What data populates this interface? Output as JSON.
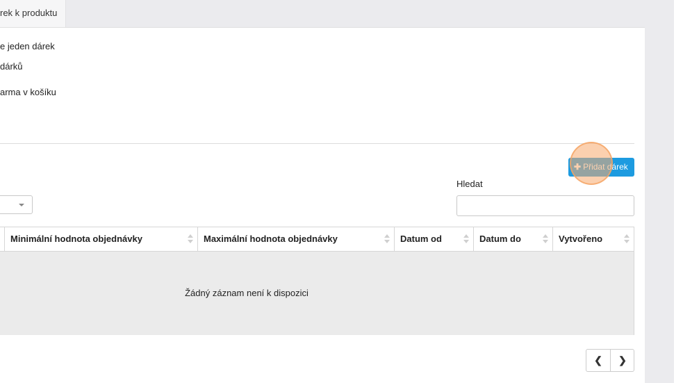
{
  "tab": {
    "label": "rek k produktu"
  },
  "options": [
    {
      "label": "e jeden dárek"
    },
    {
      "label": "dárků"
    },
    {
      "label": "arma v košíku"
    }
  ],
  "toolbar": {
    "add_button_label": "Přidat dárek",
    "add_icon": "plus-icon"
  },
  "search": {
    "label": "Hledat",
    "value": "",
    "placeholder": ""
  },
  "table": {
    "columns": [
      {
        "label": "Minimální hodnota objednávky"
      },
      {
        "label": "Maximální hodnota objednávky"
      },
      {
        "label": "Datum od"
      },
      {
        "label": "Datum do"
      },
      {
        "label": "Vytvořeno"
      }
    ],
    "empty_message": "Žádný záznam není k dispozici"
  },
  "pagination": {
    "prev_icon": "chevron-left-icon",
    "next_icon": "chevron-right-icon"
  },
  "colors": {
    "accent": "#1d9be0",
    "click_marker": "#f7aa6e"
  }
}
